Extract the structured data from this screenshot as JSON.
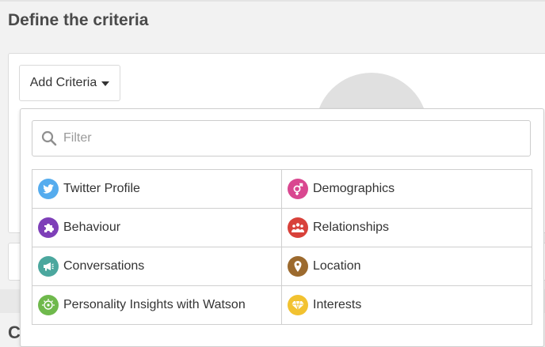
{
  "page": {
    "title": "Define the criteria",
    "next_heading_partial": "C"
  },
  "toolbar": {
    "add_criteria_label": "Add Criteria"
  },
  "filter": {
    "placeholder": "Filter",
    "value": ""
  },
  "criteria": {
    "items": [
      {
        "label": "Twitter Profile",
        "icon": "twitter-bird-icon",
        "color": "#55acee"
      },
      {
        "label": "Demographics",
        "icon": "gender-icon",
        "color": "#d94790"
      },
      {
        "label": "Behaviour",
        "icon": "puzzle-piece-icon",
        "color": "#7e3fb8"
      },
      {
        "label": "Relationships",
        "icon": "people-group-icon",
        "color": "#d8413a"
      },
      {
        "label": "Conversations",
        "icon": "megaphone-icon",
        "color": "#4ba79e"
      },
      {
        "label": "Location",
        "icon": "map-marker-icon",
        "color": "#9c6a2e"
      },
      {
        "label": "Personality Insights with Watson",
        "icon": "watson-icon",
        "color": "#6fb94c"
      },
      {
        "label": "Interests",
        "icon": "diamond-icon",
        "color": "#f2c230"
      }
    ]
  }
}
